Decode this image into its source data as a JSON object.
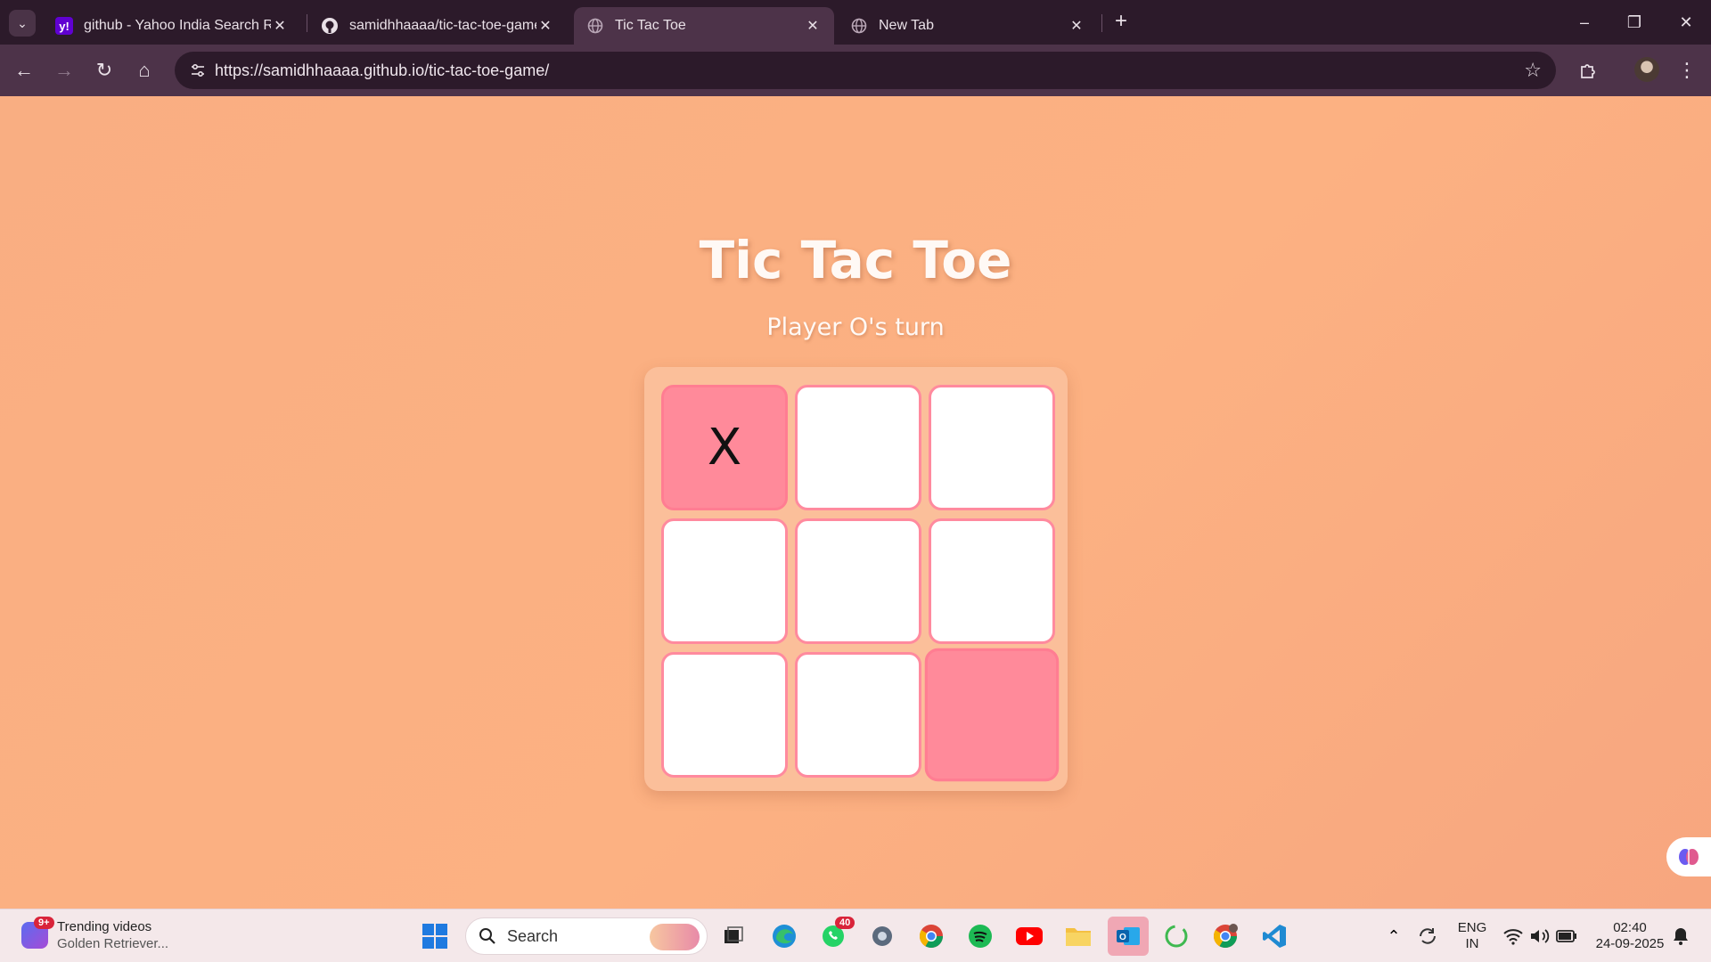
{
  "browser": {
    "tabs": [
      {
        "title": "github - Yahoo India Search Res",
        "favicon": "yahoo-icon",
        "favicon_color": "#6001d2"
      },
      {
        "title": "samidhhaaaa/tic-tac-toe-game",
        "favicon": "github-icon"
      },
      {
        "title": "Tic Tac Toe",
        "favicon": "globe-icon",
        "active": true
      },
      {
        "title": "New Tab",
        "favicon": "globe-icon"
      }
    ],
    "url": "https://samidhhaaaa.github.io/tic-tac-toe-game/",
    "colors": {
      "titlebar": "#2c1a2a",
      "toolbar": "#4d3349"
    }
  },
  "game": {
    "title": "Tic Tac Toe",
    "status": "Player O's turn",
    "board": [
      "X",
      "",
      "",
      "",
      "",
      "",
      "",
      "",
      ""
    ],
    "highlighted_cells": [
      0,
      8
    ],
    "colors": {
      "background": "#f9ad82",
      "cell": "#ffffff",
      "cell_border": "#ff8a9e",
      "highlight": "#ff8a9a"
    }
  },
  "taskbar": {
    "widget": {
      "title": "Trending videos",
      "subtitle": "Golden Retriever...",
      "badge": "9+"
    },
    "search_label": "Search",
    "whatsapp_badge": "40",
    "language": {
      "line1": "ENG",
      "line2": "IN"
    },
    "clock": {
      "time": "02:40",
      "date": "24-09-2025"
    },
    "apps": [
      "windows-start-icon",
      "search-icon",
      "task-view-icon",
      "edge-icon",
      "whatsapp-icon",
      "settings-icon",
      "chrome-icon",
      "spotify-icon",
      "youtube-icon",
      "file-explorer-icon",
      "outlook-icon",
      "refresh-app-icon",
      "chrome-profile-icon",
      "vscode-icon"
    ]
  }
}
